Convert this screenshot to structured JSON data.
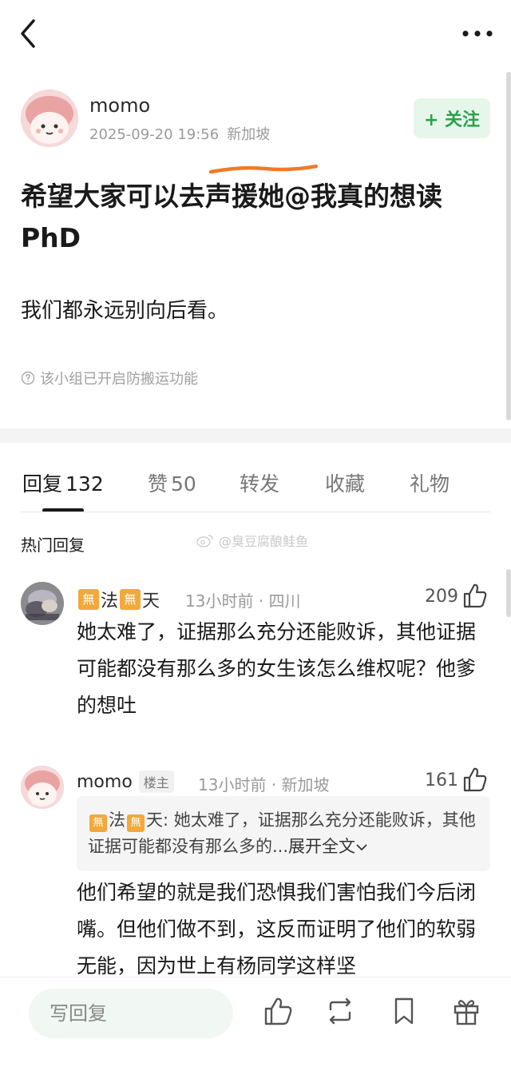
{
  "post": {
    "author": "momo",
    "timestamp": "2025-09-20 19:56",
    "location": "新加坡",
    "follow_label": "+ 关注",
    "title": "希望大家可以去声援她@我真的想读PhD",
    "body": "我们都永远别向后看。",
    "notice": "该小组已开启防搬运功能"
  },
  "tabs": [
    {
      "label": "回复",
      "count": "132"
    },
    {
      "label": "赞",
      "count": "50"
    },
    {
      "label": "转发",
      "count": ""
    },
    {
      "label": "收藏",
      "count": ""
    },
    {
      "label": "礼物",
      "count": ""
    }
  ],
  "hot_replies_label": "热门回复",
  "watermark": "@臭豆腐酿鲑鱼",
  "comments": [
    {
      "badge": "無",
      "name_mid": "法",
      "name_end": "天",
      "meta": "13小时前 · 四川",
      "likes": "209",
      "text": "她太难了，证据那么充分还能败诉，其他证据可能都没有那么多的女生该怎么维权呢？他爹的想吐"
    },
    {
      "name": "momo",
      "owner_tag": "楼主",
      "meta": "13小时前 · 新加坡",
      "likes": "161",
      "quote_badge": "無",
      "quote_mid": "法",
      "quote_end": "天",
      "quote_text": ": 她太难了，证据那么充分还能败诉，其他证据可能都没有那么多的...",
      "quote_expand": "展开全文",
      "text": "他们希望的就是我们恐惧我们害怕我们今后闭嘴。但他们做不到，这反而证明了他们的软弱无能，因为世上有杨同学这样坚"
    }
  ],
  "bottom": {
    "reply_placeholder": "写回复"
  },
  "colors": {
    "follow_green": "#2aa14a",
    "follow_bg": "#e7f6ea",
    "badge_orange": "#f2a93b",
    "underline_orange": "#f07a2a"
  }
}
